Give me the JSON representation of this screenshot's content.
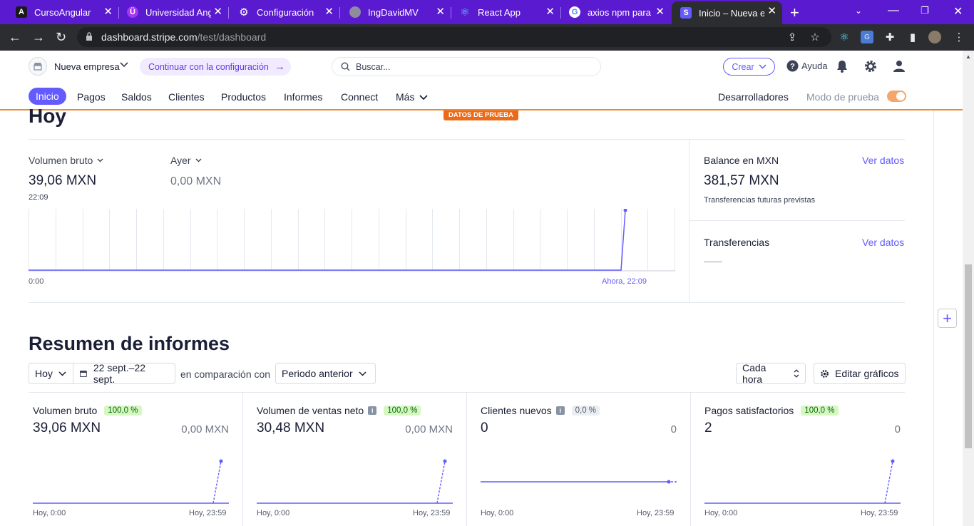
{
  "browser": {
    "tabs": [
      {
        "title": "CursoAngular",
        "favicon": "angular-icon"
      },
      {
        "title": "Universidad Angular",
        "favicon": "udemy-icon"
      },
      {
        "title": "Configuración",
        "favicon": "gear-icon"
      },
      {
        "title": "IngDavidMV",
        "favicon": "globe-icon"
      },
      {
        "title": "React App",
        "favicon": "react-icon"
      },
      {
        "title": "axios npm para q",
        "favicon": "google-icon"
      },
      {
        "title": "Inicio – Nueva em",
        "favicon": "stripe-icon"
      }
    ],
    "url_host": "dashboard.stripe.com",
    "url_path": "/test/dashboard"
  },
  "header": {
    "account_name": "Nueva empresa",
    "continue_label": "Continuar con la configuración",
    "search_placeholder": "Buscar...",
    "create_label": "Crear",
    "help_label": "Ayuda"
  },
  "nav": {
    "items": [
      "Inicio",
      "Pagos",
      "Saldos",
      "Clientes",
      "Productos",
      "Informes",
      "Connect",
      "Más"
    ],
    "developers": "Desarrolladores",
    "test_mode": "Modo de prueba",
    "test_badge": "DATOS DE PRUEBA"
  },
  "today": {
    "title": "Hoy",
    "gross_label": "Volumen bruto",
    "gross_value": "39,06 MXN",
    "gross_time": "22:09",
    "yesterday_label": "Ayer",
    "yesterday_value": "0,00 MXN",
    "axis_start": "0:00",
    "axis_now": "Ahora, 22:09",
    "balance_label": "Balance en MXN",
    "balance_link": "Ver datos",
    "balance_value": "381,57 MXN",
    "balance_note": "Transferencias futuras previstas",
    "transfers_label": "Transferencias",
    "transfers_link": "Ver datos",
    "transfers_value": "——"
  },
  "report": {
    "title": "Resumen de informes",
    "period": "Hoy",
    "date_range": "22 sept.–22 sept.",
    "compare_text": "en comparación con",
    "compare_period": "Periodo anterior",
    "interval": "Cada hora",
    "edit_label": "Editar gráficos",
    "cards": [
      {
        "title": "Volumen bruto",
        "badge": "100,0 %",
        "value": "39,06 MXN",
        "previous": "0,00 MXN",
        "x_start": "Hoy, 0:00",
        "x_end": "Hoy, 23:59",
        "info": false
      },
      {
        "title": "Volumen de ventas neto",
        "badge": "100,0 %",
        "value": "30,48 MXN",
        "previous": "0,00 MXN",
        "x_start": "Hoy, 0:00",
        "x_end": "Hoy, 23:59",
        "info": true
      },
      {
        "title": "Clientes nuevos",
        "badge": "0,0 %",
        "value": "0",
        "previous": "0",
        "x_start": "Hoy, 0:00",
        "x_end": "Hoy, 23:59",
        "info": true
      },
      {
        "title": "Pagos satisfactorios",
        "badge": "100,0 %",
        "value": "2",
        "previous": "0",
        "x_start": "Hoy, 0:00",
        "x_end": "Hoy, 23:59",
        "info": false
      }
    ]
  },
  "colors": {
    "brand": "#635bff",
    "accent_orange": "#ec6a18",
    "browser_tabs": "#5a1ad0"
  }
}
